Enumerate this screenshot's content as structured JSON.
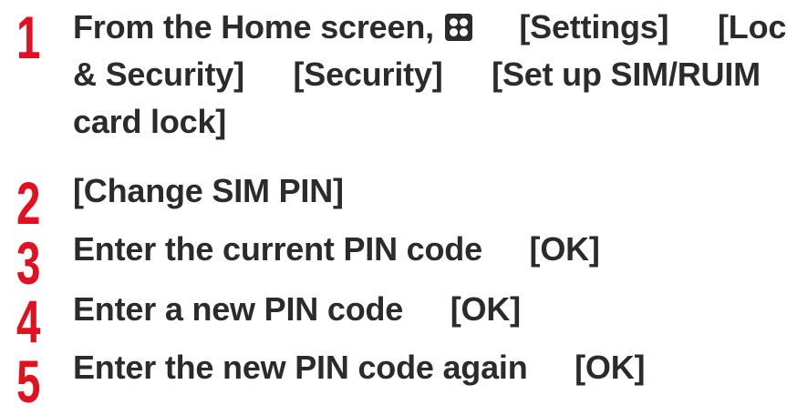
{
  "steps": [
    {
      "number": "1",
      "line1_before_icon": "From the Home screen,",
      "icon": "apps-icon",
      "line1_item1": "[Settings]",
      "line1_item2": "[Lock",
      "line2_item1": "& Security]",
      "line2_item2": "[Security]",
      "line2_item3": "[Set up SIM/RUIM",
      "line3": "card lock]"
    },
    {
      "number": "2",
      "text": "[Change SIM PIN]"
    },
    {
      "number": "3",
      "text": "Enter the current PIN code",
      "action": "[OK]"
    },
    {
      "number": "4",
      "text": "Enter a new PIN code",
      "action": "[OK]"
    },
    {
      "number": "5",
      "text": "Enter the new PIN code again",
      "action": "[OK]"
    }
  ],
  "colors": {
    "step_number": "#e1111f",
    "text": "#2b2b2b"
  }
}
